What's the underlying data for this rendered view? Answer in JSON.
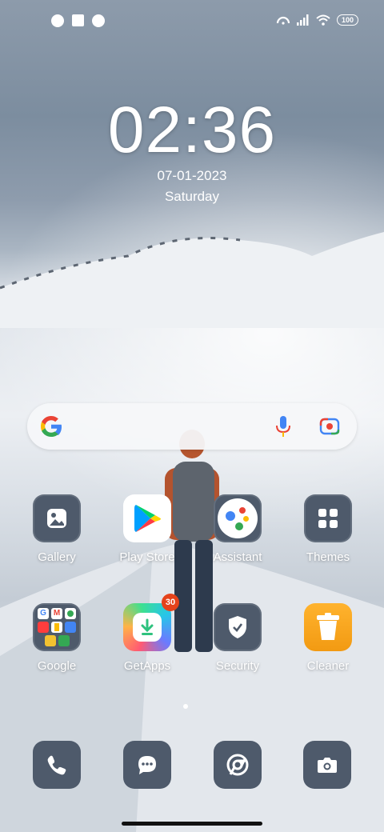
{
  "status_bar": {
    "left_icons": [
      "notification-app-icon",
      "notification-square-icon",
      "notification-app-icon"
    ],
    "right_icons": [
      "hotspot-icon",
      "signal-icon",
      "wifi-icon"
    ],
    "battery": "100"
  },
  "clock": {
    "time": "02:36",
    "date": "07-01-2023",
    "day": "Saturday"
  },
  "search_bar": {
    "icons": [
      "google-g-icon",
      "mic-icon",
      "google-lens-icon"
    ]
  },
  "apps_row1": [
    {
      "label": "Gallery",
      "icon": "gallery-icon"
    },
    {
      "label": "Play Store",
      "icon": "play-store-icon"
    },
    {
      "label": "Assistant",
      "icon": "assistant-icon"
    },
    {
      "label": "Themes",
      "icon": "themes-icon"
    }
  ],
  "apps_row2": [
    {
      "label": "Google",
      "icon": "folder-icon"
    },
    {
      "label": "GetApps",
      "icon": "getapps-icon",
      "badge": "30"
    },
    {
      "label": "Security",
      "icon": "security-icon"
    },
    {
      "label": "Cleaner",
      "icon": "cleaner-icon"
    }
  ],
  "dock": [
    {
      "icon": "phone-icon"
    },
    {
      "icon": "messages-icon"
    },
    {
      "icon": "chrome-icon"
    },
    {
      "icon": "camera-icon"
    }
  ],
  "colors": {
    "icon_slate": "#4e5a6b",
    "badge_red": "#e5431b",
    "cleaner_orange": "#f7a21b"
  }
}
